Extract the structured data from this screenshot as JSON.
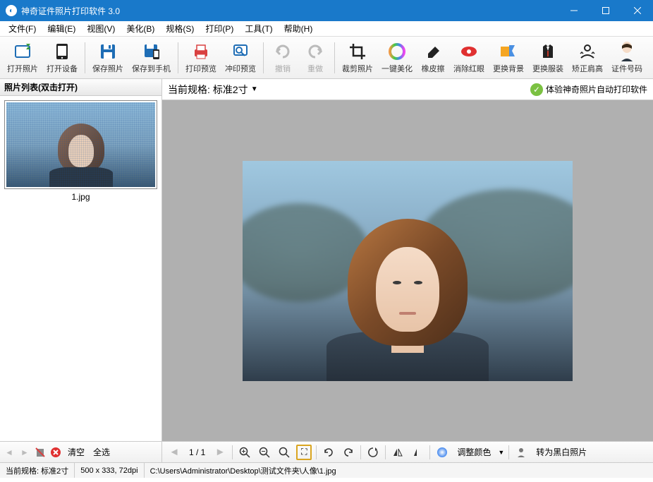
{
  "window": {
    "title": "神奇证件照片打印软件 3.0"
  },
  "menu": {
    "file": "文件(F)",
    "edit": "编辑(E)",
    "view": "视图(V)",
    "beauty": "美化(B)",
    "spec": "规格(S)",
    "print": "打印(P)",
    "tools": "工具(T)",
    "help": "帮助(H)"
  },
  "toolbar": {
    "open_photo": "打开照片",
    "open_device": "打开设备",
    "save_photo": "保存照片",
    "save_phone": "保存到手机",
    "print_preview": "打印预览",
    "dev_preview": "冲印预览",
    "undo": "撤销",
    "redo": "重做",
    "crop": "裁剪照片",
    "beautify": "一键美化",
    "eraser": "橡皮擦",
    "redeye": "消除红眼",
    "bg": "更换背景",
    "clothes": "更换服装",
    "shoulder": "矫正肩高",
    "idnum": "证件号码"
  },
  "sidebar": {
    "header": "照片列表(双击打开)",
    "thumb_name": "1.jpg",
    "clear": "清空",
    "select_all": "全选"
  },
  "canvas": {
    "spec_label": "当前规格:",
    "spec_value": "标准2寸",
    "promo": "体验神奇照片自动打印软件"
  },
  "footer": {
    "page": "1 / 1",
    "adjust_color": "调整颜色",
    "to_bw": "转为黑白照片"
  },
  "status": {
    "spec": "当前规格: 标准2寸",
    "dims": "500 x 333, 72dpi",
    "path": "C:\\Users\\Administrator\\Desktop\\测试文件夹\\人像\\1.jpg"
  }
}
